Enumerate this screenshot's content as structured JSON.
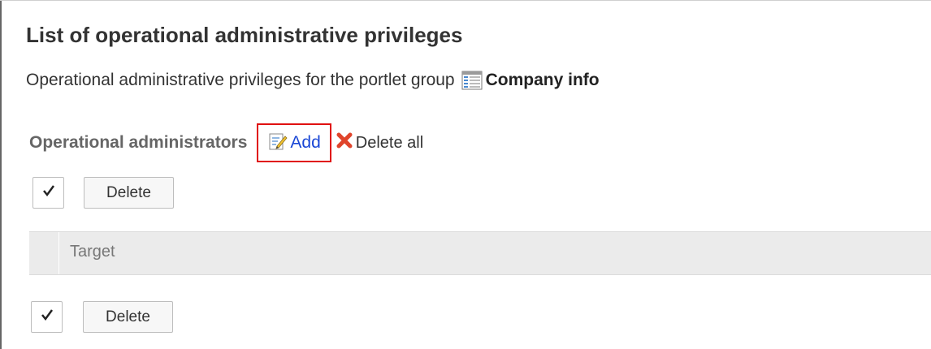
{
  "page": {
    "title": "List of operational administrative privileges",
    "description_prefix": "Operational administrative privileges for the portlet group",
    "group_name": "Company info"
  },
  "section": {
    "label": "Operational administrators",
    "add_label": "Add",
    "delete_all_label": "Delete all"
  },
  "actions_top": {
    "delete_label": "Delete"
  },
  "table": {
    "columns": [
      "Target"
    ]
  },
  "actions_bottom": {
    "delete_label": "Delete"
  },
  "colors": {
    "link": "#1a47d6",
    "highlight": "#e01010",
    "header_bg": "#ebebeb"
  }
}
